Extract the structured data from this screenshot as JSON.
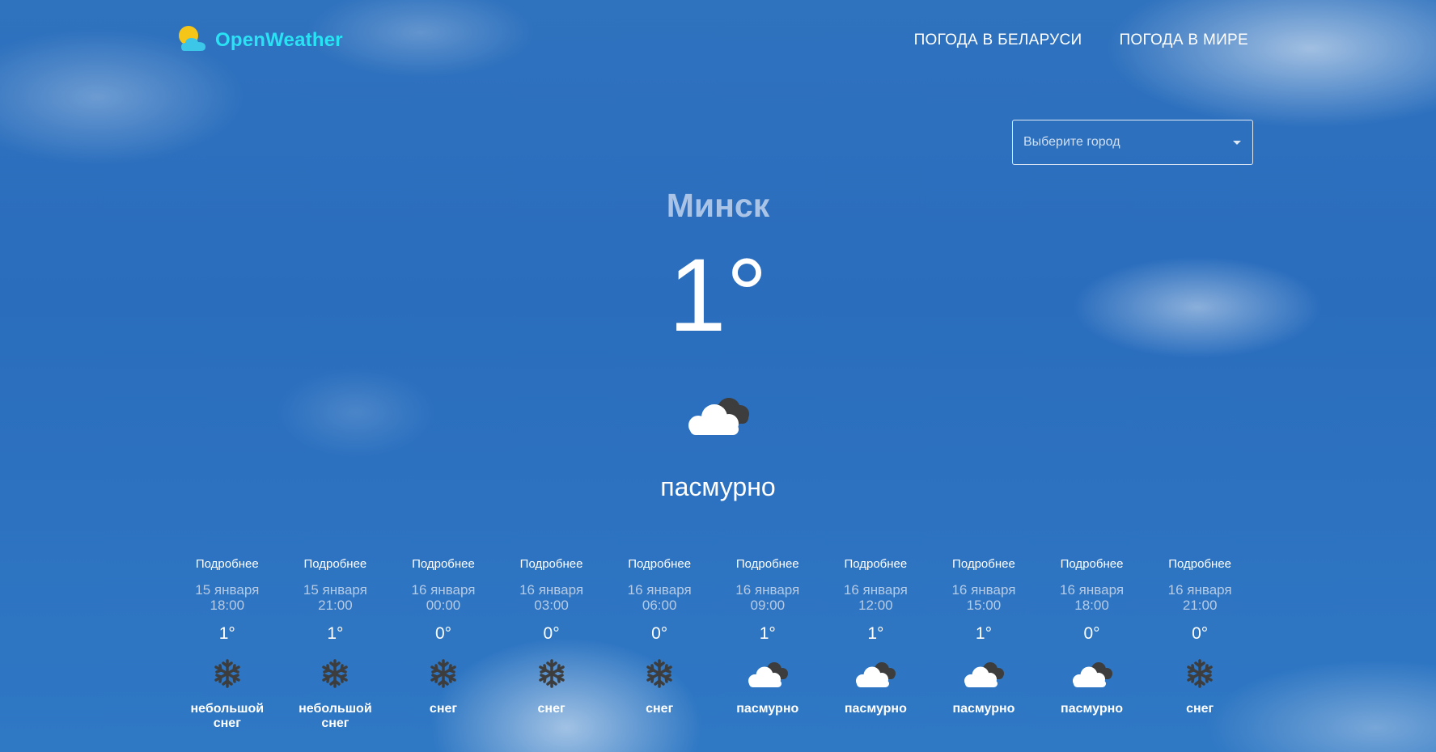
{
  "header": {
    "logo_text": "OpenWeather",
    "nav": [
      {
        "label": "ПОГОДА В БЕЛАРУСИ"
      },
      {
        "label": "ПОГОДА В МИРЕ"
      }
    ]
  },
  "city_select": {
    "placeholder": "Выберите город"
  },
  "current": {
    "city": "Минск",
    "temperature": "1°",
    "icon": "overcast-cloud-icon",
    "description": "пасмурно"
  },
  "forecast": [
    {
      "more": "Подробнее",
      "date": "15 января",
      "time": "18:00",
      "temp": "1°",
      "icon": "snowflake-icon",
      "desc": "небольшой снег"
    },
    {
      "more": "Подробнее",
      "date": "15 января",
      "time": "21:00",
      "temp": "1°",
      "icon": "snowflake-icon",
      "desc": "небольшой снег"
    },
    {
      "more": "Подробнее",
      "date": "16 января",
      "time": "00:00",
      "temp": "0°",
      "icon": "snowflake-icon",
      "desc": "снег"
    },
    {
      "more": "Подробнее",
      "date": "16 января",
      "time": "03:00",
      "temp": "0°",
      "icon": "snowflake-icon",
      "desc": "снег"
    },
    {
      "more": "Подробнее",
      "date": "16 января",
      "time": "06:00",
      "temp": "0°",
      "icon": "snowflake-icon",
      "desc": "снег"
    },
    {
      "more": "Подробнее",
      "date": "16 января",
      "time": "09:00",
      "temp": "1°",
      "icon": "overcast-cloud-icon",
      "desc": "пасмурно"
    },
    {
      "more": "Подробнее",
      "date": "16 января",
      "time": "12:00",
      "temp": "1°",
      "icon": "overcast-cloud-icon",
      "desc": "пасмурно"
    },
    {
      "more": "Подробнее",
      "date": "16 января",
      "time": "15:00",
      "temp": "1°",
      "icon": "overcast-cloud-icon",
      "desc": "пасмурно"
    },
    {
      "more": "Подробнее",
      "date": "16 января",
      "time": "18:00",
      "temp": "0°",
      "icon": "overcast-cloud-icon",
      "desc": "пасмурно"
    },
    {
      "more": "Подробнее",
      "date": "16 января",
      "time": "21:00",
      "temp": "0°",
      "icon": "snowflake-icon",
      "desc": "снег"
    }
  ],
  "colors": {
    "logo": "#29e3f5",
    "city": "#a9c4e6",
    "sky": "#2a6dbd"
  }
}
